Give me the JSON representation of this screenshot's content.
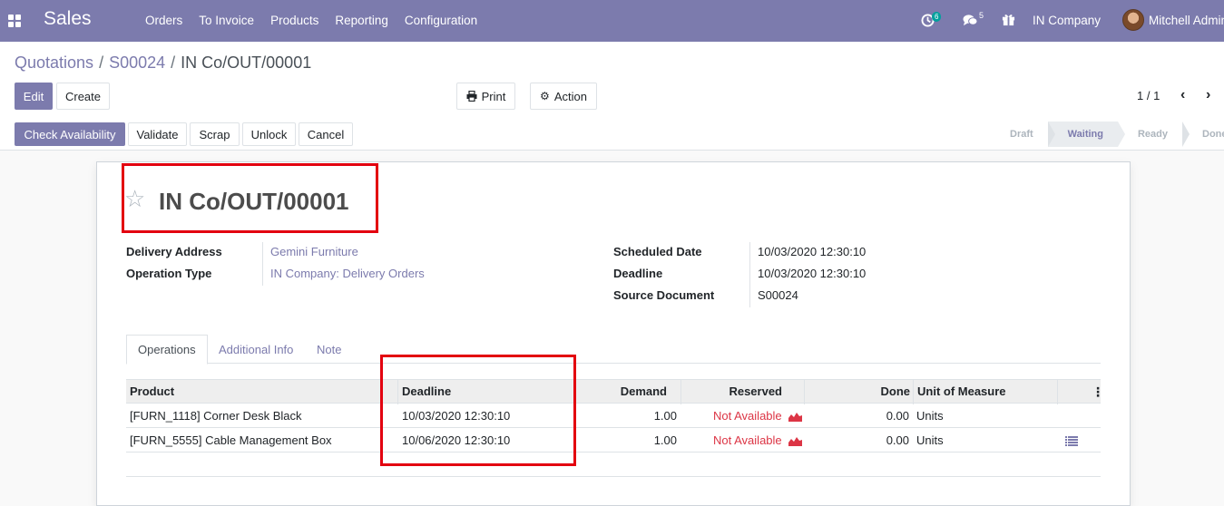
{
  "navbar": {
    "app_name": "Sales",
    "menu": [
      "Orders",
      "To Invoice",
      "Products",
      "Reporting",
      "Configuration"
    ],
    "activity_count": "6",
    "message_count": "5",
    "company": "IN Company",
    "user": "Mitchell Admin",
    "color": "#7c7bad"
  },
  "breadcrumb": {
    "items": [
      "Quotations",
      "S00024"
    ],
    "current": "IN Co/OUT/00001",
    "separator": "/"
  },
  "toolbar": {
    "edit": "Edit",
    "create": "Create",
    "print": "Print",
    "action": "Action",
    "pager": "1 / 1"
  },
  "actions": {
    "check_availability": "Check Availability",
    "validate": "Validate",
    "scrap": "Scrap",
    "unlock": "Unlock",
    "cancel": "Cancel"
  },
  "status": {
    "stages": [
      "Draft",
      "Waiting",
      "Ready",
      "Done"
    ],
    "current": "Waiting"
  },
  "record": {
    "name": "IN Co/OUT/00001",
    "fields_left": [
      {
        "label": "Delivery Address",
        "value": "Gemini Furniture"
      },
      {
        "label": "Operation Type",
        "value": "IN Company: Delivery Orders"
      }
    ],
    "fields_right": [
      {
        "label": "Scheduled Date",
        "value": "10/03/2020 12:30:10"
      },
      {
        "label": "Deadline",
        "value": "10/03/2020 12:30:10"
      },
      {
        "label": "Source Document",
        "value": "S00024"
      }
    ]
  },
  "tabs": [
    "Operations",
    "Additional Info",
    "Note"
  ],
  "operations": {
    "columns": [
      "Product",
      "Deadline",
      "Demand",
      "Reserved",
      "Done",
      "Unit of Measure"
    ],
    "rows": [
      {
        "product": "[FURN_1118] Corner Desk Black",
        "deadline": "10/03/2020 12:30:10",
        "demand": "1.00",
        "reserved": "Not Available",
        "done": "0.00",
        "uom": "Units"
      },
      {
        "product": "[FURN_5555] Cable Management Box",
        "deadline": "10/06/2020 12:30:10",
        "demand": "1.00",
        "reserved": "Not Available",
        "done": "0.00",
        "uom": "Units"
      }
    ]
  }
}
